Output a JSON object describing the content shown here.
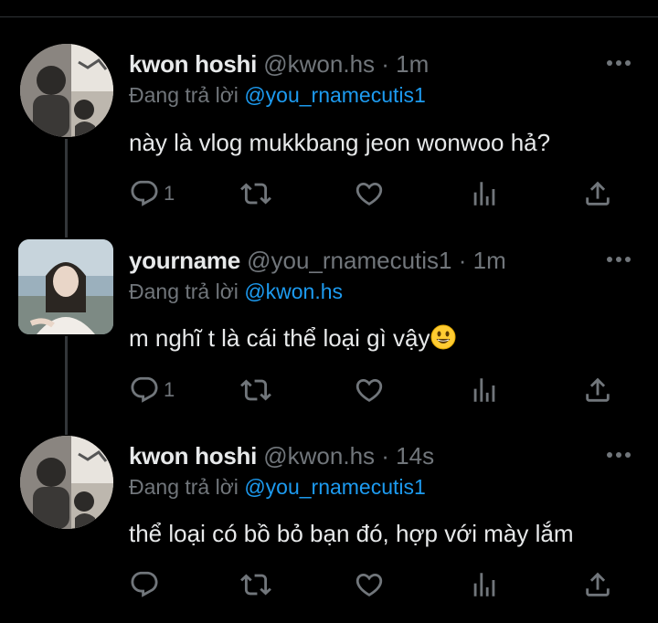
{
  "colors": {
    "background": "#000000",
    "text": "#e7e9ea",
    "muted": "#71767b",
    "accent": "#1d9bf0"
  },
  "tweets": [
    {
      "display_name": "kwon hoshi",
      "handle": "@kwon.hs",
      "separator": "·",
      "time": "1m",
      "reply_prefix": "Đang trả lời",
      "reply_to": "@you_rnamecutis1",
      "text": "này là vlog mukkbang jeon wonwoo hả?",
      "emoji": "",
      "reply_count": "1",
      "icons": [
        "reply-icon",
        "retweet-icon",
        "like-icon",
        "views-icon",
        "share-icon"
      ]
    },
    {
      "display_name": "yourname",
      "handle": "@you_rnamecutis1",
      "separator": "·",
      "time": "1m",
      "reply_prefix": "Đang trả lời",
      "reply_to": "@kwon.hs",
      "text": "m nghĩ t là cái thể loại gì vậy",
      "emoji": "smiley-face-emoji",
      "reply_count": "1",
      "icons": [
        "reply-icon",
        "retweet-icon",
        "like-icon",
        "views-icon",
        "share-icon"
      ]
    },
    {
      "display_name": "kwon hoshi",
      "handle": "@kwon.hs",
      "separator": "·",
      "time": "14s",
      "reply_prefix": "Đang trả lời",
      "reply_to": "@you_rnamecutis1",
      "text": "thể loại có bồ bỏ bạn đó, hợp với mày lắm",
      "emoji": "",
      "reply_count": "",
      "icons": [
        "reply-icon",
        "retweet-icon",
        "like-icon",
        "views-icon",
        "share-icon"
      ]
    }
  ]
}
